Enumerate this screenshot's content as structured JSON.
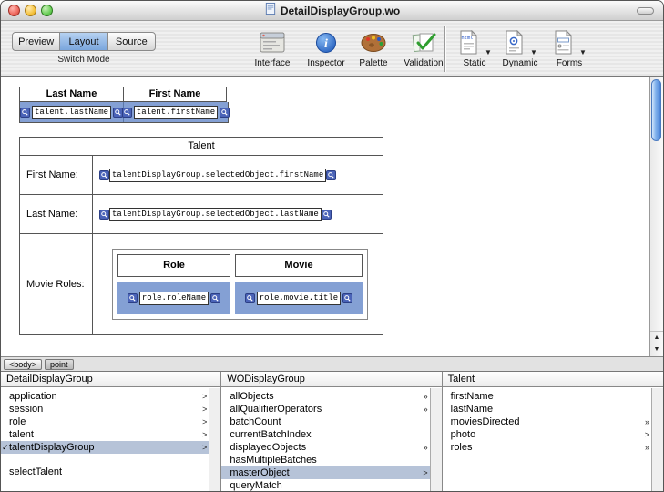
{
  "window": {
    "title": "DetailDisplayGroup.wo"
  },
  "toolbar": {
    "mode_caption": "Switch Mode",
    "mode_segments": [
      {
        "label": "Preview",
        "selected": false
      },
      {
        "label": "Layout",
        "selected": true
      },
      {
        "label": "Source",
        "selected": false
      }
    ],
    "tools": [
      {
        "label": "Interface"
      },
      {
        "label": "Inspector"
      },
      {
        "label": "Palette"
      },
      {
        "label": "Validation"
      }
    ],
    "element_menus": [
      {
        "label": "Static"
      },
      {
        "label": "Dynamic"
      },
      {
        "label": "Forms"
      }
    ]
  },
  "canvas": {
    "list_table": {
      "headers": [
        "Last Name",
        "First Name"
      ],
      "cells": [
        "talent.lastName",
        "talent.firstName"
      ]
    },
    "detail_table": {
      "title": "Talent",
      "rows": [
        {
          "label": "First Name:",
          "binding": "talentDisplayGroup.selectedObject.firstName"
        },
        {
          "label": "Last Name:",
          "binding": "talentDisplayGroup.selectedObject.lastName"
        }
      ],
      "roles_row": {
        "label": "Movie Roles:",
        "columns": [
          {
            "header": "Role",
            "binding": "role.roleName"
          },
          {
            "header": "Movie",
            "binding": "role.movie.title"
          }
        ]
      }
    },
    "path_bar": [
      {
        "label": "<body>"
      },
      {
        "label": "point"
      }
    ]
  },
  "browser": {
    "columns": [
      {
        "header": "DetailDisplayGroup",
        "items": [
          {
            "label": "application",
            "arrow": ">"
          },
          {
            "label": "session",
            "arrow": ">"
          },
          {
            "label": "role",
            "arrow": ">"
          },
          {
            "label": "talent",
            "arrow": ">"
          },
          {
            "label": "talentDisplayGroup",
            "arrow": ">",
            "selected": true,
            "check": "✓"
          },
          {
            "label": "selectTalent",
            "arrow": ""
          }
        ]
      },
      {
        "header": "WODisplayGroup",
        "items": [
          {
            "label": "allObjects",
            "arrow": "»"
          },
          {
            "label": "allQualifierOperators",
            "arrow": "»"
          },
          {
            "label": "batchCount",
            "arrow": ""
          },
          {
            "label": "currentBatchIndex",
            "arrow": ""
          },
          {
            "label": "displayedObjects",
            "arrow": "»"
          },
          {
            "label": "hasMultipleBatches",
            "arrow": ""
          },
          {
            "label": "masterObject",
            "arrow": ">",
            "selected": true
          },
          {
            "label": "queryMatch",
            "arrow": ""
          }
        ]
      },
      {
        "header": "Talent",
        "items": [
          {
            "label": "firstName",
            "arrow": ""
          },
          {
            "label": "lastName",
            "arrow": ""
          },
          {
            "label": "moviesDirected",
            "arrow": "»"
          },
          {
            "label": "photo",
            "arrow": ">"
          },
          {
            "label": "roles",
            "arrow": "»"
          }
        ]
      }
    ]
  },
  "colors": {
    "canvas_selection": "#84a0d4",
    "browser_selection": "#b6c3d8",
    "segment_selected": "#7aa6dd",
    "marker_blue": "#4a63b8"
  }
}
